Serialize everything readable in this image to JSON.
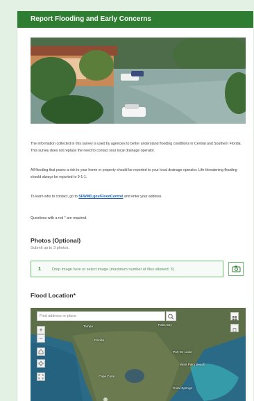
{
  "form": {
    "title": "Report Flooding and Early Concerns",
    "intro_p1": "The information collected in this survey is used by agencies to better understand flooding conditions in Central and Southern Florida. This survey does not replace the need to contact your local drainage operator.",
    "intro_p2": "All flooding that poses a risk to your home or property should be reported to your local drainage operator. Life-threatening flooding should always be reported to 9-1-1.",
    "intro_p3_prefix": "To learn who to contact, go to ",
    "intro_p3_link": "SFWMD.gov/FloodControl",
    "intro_p3_suffix": " and enter your address.",
    "required_note": "Questions with a red * are required."
  },
  "photos": {
    "heading": "Photos (Optional)",
    "subtext": "Submit up to 3 photos.",
    "drop_number": "1",
    "drop_text": "Drop image here or select image (maximum number of files allowed: 3)"
  },
  "location": {
    "heading": "Flood Location*",
    "search_placeholder": "Find address or place",
    "zoom_in": "+",
    "zoom_out": "−"
  },
  "map_labels": {
    "tampa": "Tampa",
    "palm_bay": "Palm Bay",
    "florida": "Florida",
    "port_st_lucie": "Port St. Lucie",
    "west_palm_beach": "West Palm Beach",
    "cape_coral": "Cape Coral",
    "coral_springs": "Coral Springs"
  },
  "colors": {
    "header_green": "#2e7d32",
    "page_bg": "#e3f0e4",
    "link_blue": "#1a5fb4",
    "drop_border": "#6fbf73"
  },
  "icons": {
    "search": "search-icon",
    "home": "home-icon",
    "locate": "locate-icon",
    "fullscreen": "fullscreen-icon",
    "basemap": "basemap-gallery-icon",
    "camera": "camera-icon"
  }
}
